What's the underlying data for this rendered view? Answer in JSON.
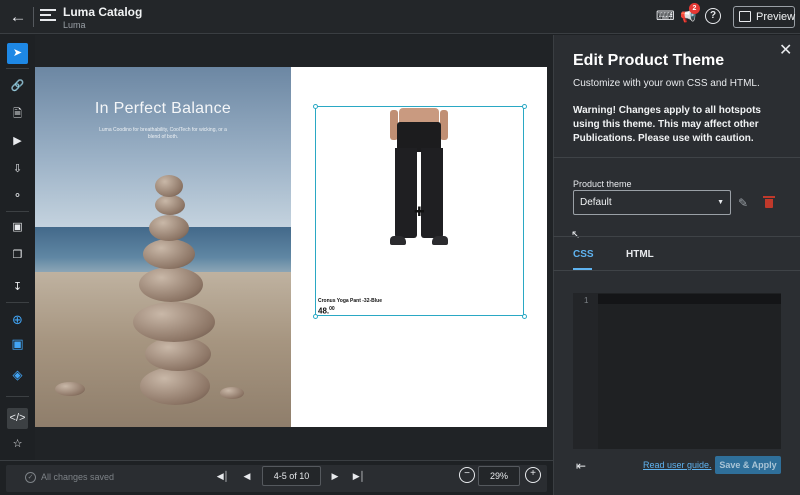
{
  "header": {
    "title": "Luma Catalog",
    "subtitle": "Luma",
    "notification_count": "2",
    "preview_label": "Preview",
    "icons": [
      "back-arrow-icon",
      "menu-icon",
      "keyboard-icon",
      "megaphone-icon",
      "help-icon",
      "preview-icon"
    ]
  },
  "toolbar": {
    "tools": [
      "select-icon",
      "link-icon",
      "page-link-icon",
      "video-icon",
      "import-icon",
      "tag-icon",
      "image-icon",
      "duplicate-icon",
      "download-icon",
      "add-icon",
      "comment-icon",
      "palette-icon",
      "code-icon",
      "accessibility-icon"
    ]
  },
  "page": {
    "heading": "In Perfect Balance",
    "caption": "Luma Coodino for breathability, CoolTech for wicking, or a blend of both."
  },
  "product": {
    "name": "Cronus Yoga Pant -32-Blue",
    "price": "48.",
    "price_cents": "00"
  },
  "footer": {
    "status": "All changes saved",
    "page_indicator": "4-5 of 10",
    "zoom": "29%"
  },
  "panel": {
    "title": "Edit Product Theme",
    "subtitle": "Customize with your own CSS and HTML.",
    "warning": "Warning! Changes apply to all hotspots using this theme. This may affect other Publications. Please use with caution.",
    "theme_label": "Product theme",
    "theme_value": "Default",
    "tabs": [
      {
        "label": "CSS",
        "active": true
      },
      {
        "label": "HTML",
        "active": false
      }
    ],
    "line_number": "1",
    "guide_link": "Read user guide.",
    "apply_label": "Save & Apply"
  },
  "colors": {
    "accent": "#1e88e5",
    "link": "#5fb3f0",
    "hotspot_border": "#2aa8c4",
    "delete": "#c0392b",
    "badge": "#e53935"
  }
}
